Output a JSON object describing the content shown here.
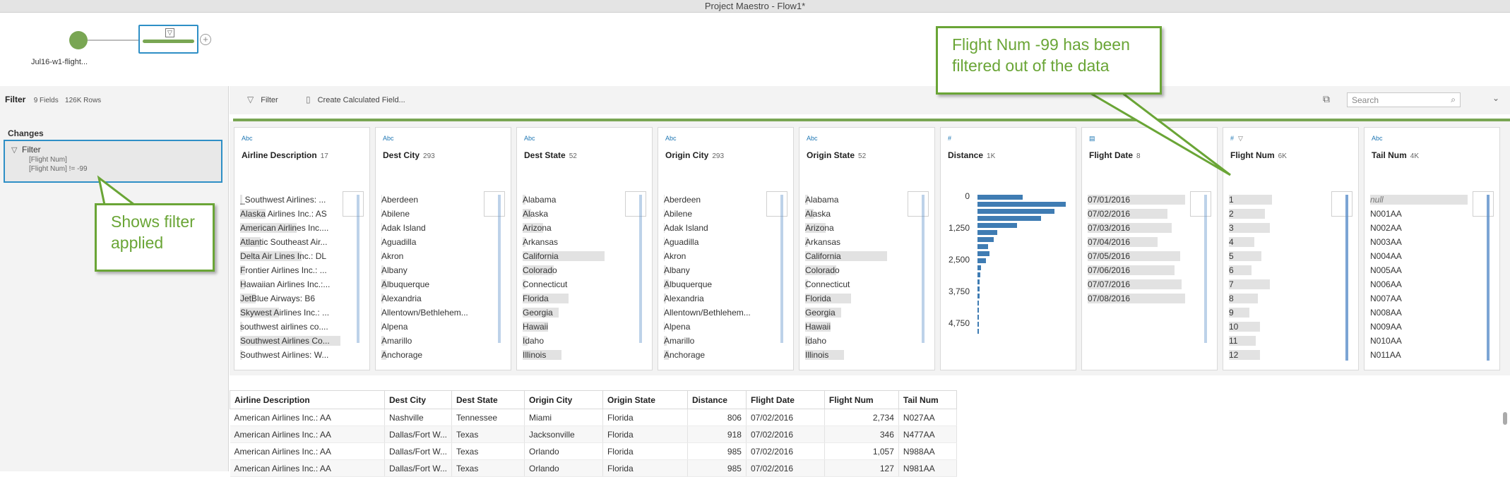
{
  "window": {
    "title": "Project Maestro - Flow1*"
  },
  "flow": {
    "input_label": "Jul16-w1-flight..."
  },
  "left_panel": {
    "title": "Filter",
    "fields": "9 Fields",
    "rows": "126K Rows",
    "changes_heading": "Changes",
    "change_item": {
      "title": "Filter",
      "line1": "[Flight Num]",
      "line2": "[Flight Num] != -99"
    }
  },
  "toolbar": {
    "filter_label": "Filter",
    "calc_label": "Create Calculated Field...",
    "search_placeholder": "Search"
  },
  "cards": [
    {
      "type": "Abc",
      "name": "Airline Description",
      "count": "17",
      "values": [
        "_Southwest Airlines: ...",
        "Alaska Airlines Inc.: AS",
        "American Airlines Inc....",
        "Atlantic Southeast Air...",
        "Delta Air Lines Inc.: DL",
        "Frontier Airlines Inc.: ...",
        "Hawaiian Airlines Inc.:...",
        "JetBlue Airways: B6",
        "Skywest Airlines Inc.: ...",
        "southwest airlines co....",
        "Southwest Airlines Co...",
        "Southwest Airlines: W..."
      ],
      "fills": [
        0.02,
        0.25,
        0.55,
        0.2,
        0.6,
        0.05,
        0.05,
        0.15,
        0.38,
        0.02,
        0.98,
        0.02
      ]
    },
    {
      "type": "Abc",
      "name": "Dest City",
      "count": "293",
      "values": [
        "Aberdeen",
        "Abilene",
        "Adak Island",
        "Aguadilla",
        "Akron",
        "Albany",
        "Albuquerque",
        "Alexandria",
        "Allentown/Bethlehem...",
        "Alpena",
        "Amarillo",
        "Anchorage"
      ],
      "fills": [
        0.01,
        0.01,
        0.01,
        0.01,
        0.01,
        0.02,
        0.05,
        0.02,
        0.01,
        0.01,
        0.03,
        0.05
      ]
    },
    {
      "type": "Abc",
      "name": "Dest State",
      "count": "52",
      "values": [
        "Alabama",
        "Alaska",
        "Arizona",
        "Arkansas",
        "California",
        "Colorado",
        "Connecticut",
        "Florida",
        "Georgia",
        "Hawaii",
        "Idaho",
        "Illinois"
      ],
      "fills": [
        0.03,
        0.08,
        0.2,
        0.03,
        0.8,
        0.3,
        0.03,
        0.45,
        0.35,
        0.25,
        0.05,
        0.38
      ]
    },
    {
      "type": "Abc",
      "name": "Origin City",
      "count": "293",
      "values": [
        "Aberdeen",
        "Abilene",
        "Adak Island",
        "Aguadilla",
        "Akron",
        "Albany",
        "Albuquerque",
        "Alexandria",
        "Allentown/Bethlehem...",
        "Alpena",
        "Amarillo",
        "Anchorage"
      ],
      "fills": [
        0.01,
        0.01,
        0.01,
        0.01,
        0.01,
        0.02,
        0.05,
        0.02,
        0.01,
        0.01,
        0.03,
        0.05
      ]
    },
    {
      "type": "Abc",
      "name": "Origin State",
      "count": "52",
      "values": [
        "Alabama",
        "Alaska",
        "Arizona",
        "Arkansas",
        "California",
        "Colorado",
        "Connecticut",
        "Florida",
        "Georgia",
        "Hawaii",
        "Idaho",
        "Illinois"
      ],
      "fills": [
        0.03,
        0.08,
        0.2,
        0.03,
        0.8,
        0.3,
        0.03,
        0.45,
        0.35,
        0.25,
        0.05,
        0.38
      ]
    },
    {
      "type": "#",
      "name": "Distance",
      "count": "1K",
      "dist_labels": [
        "0",
        "1,250",
        "2,500",
        "3,750",
        "4,750"
      ],
      "dist_bars": [
        0.5,
        0.98,
        0.85,
        0.7,
        0.44,
        0.22,
        0.18,
        0.12,
        0.13,
        0.09,
        0.04,
        0.03,
        0.02,
        0.02,
        0.02,
        0.01,
        0.01,
        0.01,
        0.01,
        0.01
      ]
    },
    {
      "type": "cal",
      "name": "Flight Date",
      "count": "8",
      "values": [
        "07/01/2016",
        "07/02/2016",
        "07/03/2016",
        "07/04/2016",
        "07/05/2016",
        "07/06/2016",
        "07/07/2016",
        "07/08/2016"
      ],
      "fills": [
        0.95,
        0.78,
        0.82,
        0.68,
        0.9,
        0.85,
        0.92,
        0.95
      ]
    },
    {
      "type": "#",
      "filtered": true,
      "name": "Flight Num",
      "count": "6K",
      "values": [
        "1",
        "2",
        "3",
        "4",
        "5",
        "6",
        "7",
        "8",
        "9",
        "10",
        "11",
        "12"
      ],
      "fills": [
        0.42,
        0.35,
        0.4,
        0.25,
        0.32,
        0.22,
        0.4,
        0.28,
        0.2,
        0.3,
        0.26,
        0.3
      ]
    },
    {
      "type": "Abc",
      "name": "Tail Num",
      "count": "4K",
      "values": [
        "null",
        "N001AA",
        "N002AA",
        "N003AA",
        "N004AA",
        "N005AA",
        "N006AA",
        "N007AA",
        "N008AA",
        "N009AA",
        "N010AA",
        "N011AA"
      ],
      "fills": [
        0.95,
        0,
        0,
        0,
        0,
        0,
        0,
        0,
        0,
        0,
        0,
        0
      ]
    }
  ],
  "grid": {
    "columns": [
      "Airline Description",
      "Dest City",
      "Dest State",
      "Origin City",
      "Origin State",
      "Distance",
      "Flight Date",
      "Flight Num",
      "Tail Num"
    ],
    "rows": [
      [
        "American Airlines Inc.: AA",
        "Nashville",
        "Tennessee",
        "Miami",
        "Florida",
        "806",
        "07/02/2016",
        "2,734",
        "N027AA"
      ],
      [
        "American Airlines Inc.: AA",
        "Dallas/Fort W...",
        "Texas",
        "Jacksonville",
        "Florida",
        "918",
        "07/02/2016",
        "346",
        "N477AA"
      ],
      [
        "American Airlines Inc.: AA",
        "Dallas/Fort W...",
        "Texas",
        "Orlando",
        "Florida",
        "985",
        "07/02/2016",
        "1,057",
        "N988AA"
      ],
      [
        "American Airlines Inc.: AA",
        "Dallas/Fort W...",
        "Texas",
        "Orlando",
        "Florida",
        "985",
        "07/02/2016",
        "127",
        "N981AA"
      ]
    ]
  },
  "callouts": {
    "flight": "Flight Num -99 has been filtered out of the data",
    "filter": "Shows filter applied"
  },
  "colors": {
    "accent_green": "#79a653",
    "selection_blue": "#2e8fc6",
    "bar_blue": "#3f7cb3",
    "callout_green": "#6aa536"
  }
}
